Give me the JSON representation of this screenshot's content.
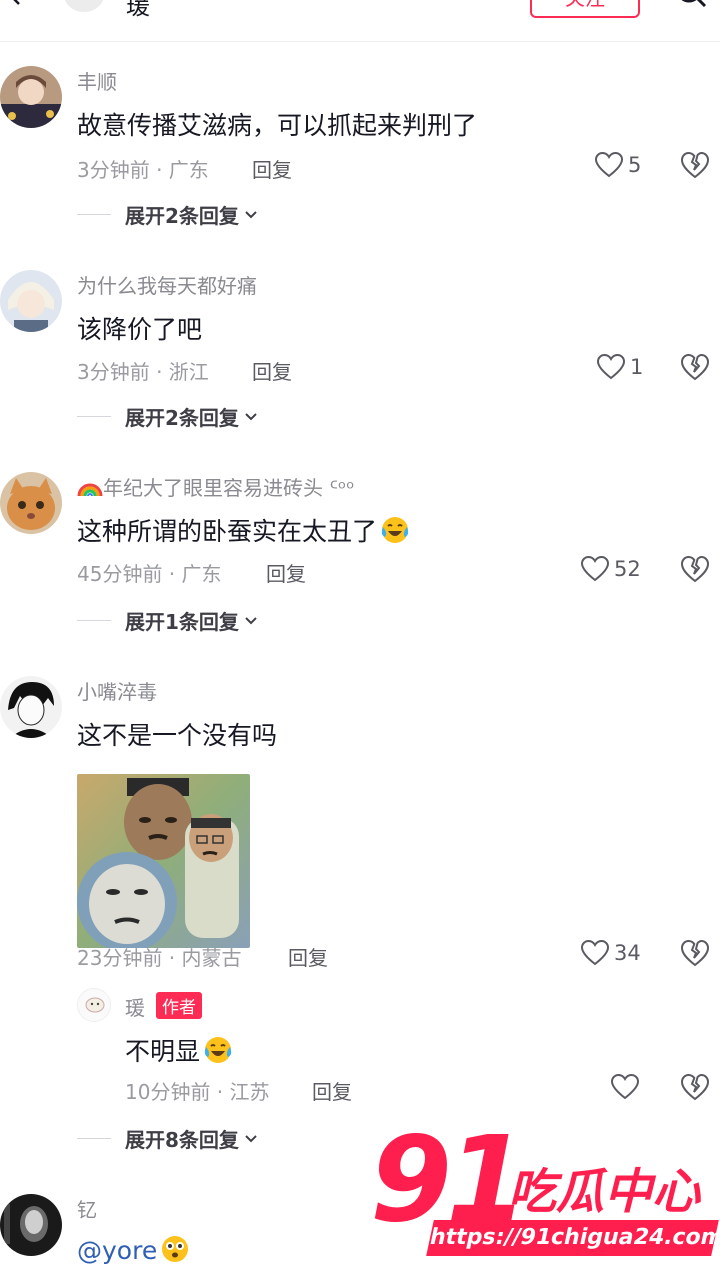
{
  "header": {
    "title": "瑗",
    "follow_label": "关注"
  },
  "comments": [
    {
      "username": "丰顺",
      "text": "故意传播艾滋病，可以抓起来判刑了",
      "meta": "3分钟前 · 广东",
      "reply_label": "回复",
      "likes": "5",
      "expand_label": "展开2条回复"
    },
    {
      "username": "为什么我每天都好痛",
      "text": "该降价了吧",
      "meta": "3分钟前 · 浙江",
      "reply_label": "回复",
      "likes": "1",
      "expand_label": "展开2条回复"
    },
    {
      "username": "年纪大了眼里容易进砖头 ᑦᵒᵒ",
      "text": "这种所谓的卧蚕实在太丑了",
      "meta": "45分钟前 · 广东",
      "reply_label": "回复",
      "likes": "52",
      "expand_label": "展开1条回复"
    },
    {
      "username": "小嘴淬毒",
      "text": "这不是一个没有吗",
      "meta": "23分钟前 · 内蒙古",
      "reply_label": "回复",
      "likes": "34",
      "reply": {
        "username": "瑗",
        "badge": "作者",
        "text": "不明显",
        "meta": "10分钟前 · 江苏",
        "reply_label": "回复"
      },
      "expand_label": "展开8条回复"
    },
    {
      "username": "钇",
      "text": "@yore"
    }
  ],
  "watermark": {
    "number": "91",
    "name": "吃瓜中心",
    "url": "https://91chigua24.com"
  },
  "colors": {
    "accent": "#fe2c55",
    "watermark": "#ff1f4e"
  }
}
